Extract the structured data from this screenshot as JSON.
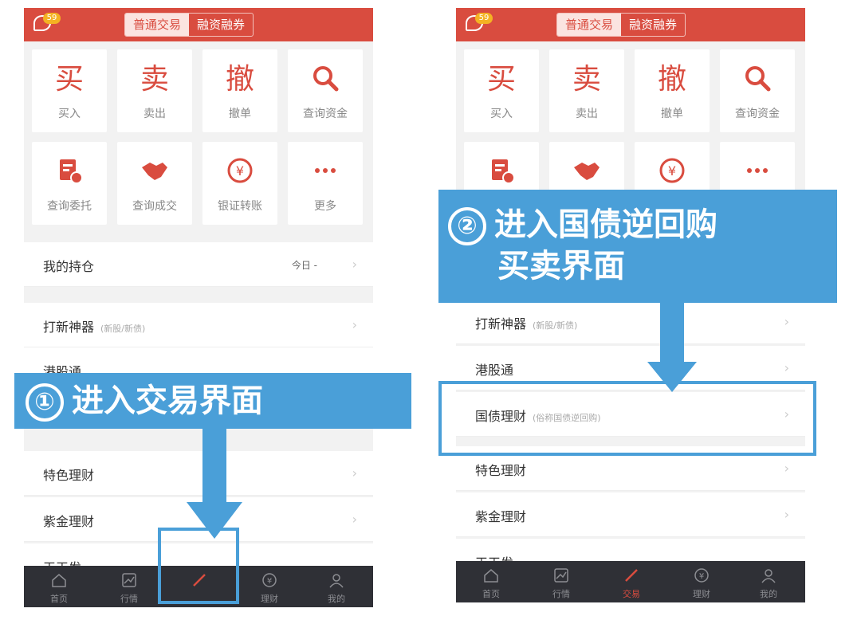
{
  "header": {
    "badge": "59",
    "tab_normal": "普通交易",
    "tab_margin": "融资融券"
  },
  "grid": [
    {
      "glyph": "买",
      "label": "买入"
    },
    {
      "glyph": "卖",
      "label": "卖出"
    },
    {
      "glyph": "撤",
      "label": "撤单"
    },
    {
      "icon": "search-icon",
      "label": "查询资金"
    },
    {
      "icon": "document-clock-icon",
      "label": "查询委托"
    },
    {
      "icon": "handshake-icon",
      "label": "查询成交"
    },
    {
      "icon": "yen-transfer-icon",
      "label": "银证转账"
    },
    {
      "icon": "more-icon",
      "label": "更多"
    }
  ],
  "list1": {
    "holdings": {
      "title": "我的持仓",
      "right": "今日 -"
    },
    "ipo": {
      "title": "打新神器",
      "sub": "(新股/新债)"
    },
    "hk": {
      "title": "港股通"
    },
    "special": {
      "title": "特色理财"
    },
    "gold": {
      "title": "紫金理财"
    },
    "daily": {
      "title": "天天发"
    }
  },
  "list2": {
    "ipo": {
      "title": "打新神器",
      "sub": "(新股/新债)"
    },
    "hk": {
      "title": "港股通"
    },
    "bond": {
      "title": "国债理财",
      "sub": "(俗称国债逆回购)"
    },
    "special": {
      "title": "特色理财"
    },
    "gold": {
      "title": "紫金理财"
    },
    "daily": {
      "title": "天天发"
    }
  },
  "nav": [
    {
      "icon": "home-icon",
      "label": "首页"
    },
    {
      "icon": "chart-icon",
      "label": "行情"
    },
    {
      "icon": "trade-icon",
      "label": "交易"
    },
    {
      "icon": "yen-icon",
      "label": "理财"
    },
    {
      "icon": "user-icon",
      "label": "我的"
    }
  ],
  "annotations": {
    "step1_num": "①",
    "step1_text": "进入交易界面",
    "step2_num": "②",
    "step2_line1": "进入国债逆回购",
    "step2_line2": "买卖界面"
  },
  "colors": {
    "brand_red": "#d94c3f",
    "annotation_blue": "#4a9fd8",
    "nav_bg": "#2f3036"
  }
}
